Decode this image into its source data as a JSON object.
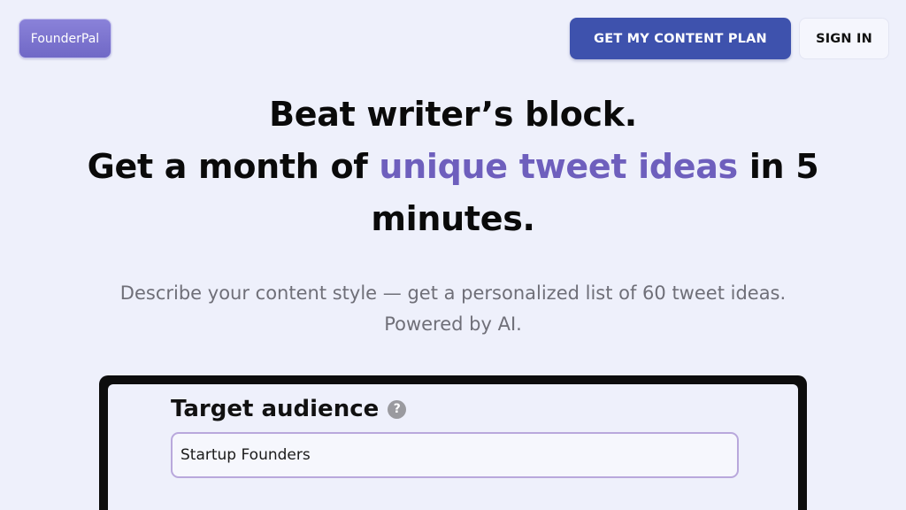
{
  "header": {
    "logo_text": "FounderPal",
    "cta_label": "GET MY CONTENT PLAN",
    "signin_label": "SIGN IN"
  },
  "hero": {
    "line1": "Beat writer’s block.",
    "line2_prefix": "Get a month of ",
    "line2_accent": "unique tweet ideas",
    "line2_suffix": " in 5",
    "line3": "minutes."
  },
  "subtitle": {
    "line1": "Describe your content style — get a personalized list of 60 tweet ideas.",
    "line2": "Powered by AI."
  },
  "form": {
    "target_audience_label": "Target audience",
    "help_icon_glyph": "?",
    "target_audience_value": "Startup Founders"
  },
  "colors": {
    "background": "#eef0fb",
    "primary_button": "#3e52ad",
    "accent_text": "#6e5fbd",
    "logo_background": "#7d74d0"
  }
}
